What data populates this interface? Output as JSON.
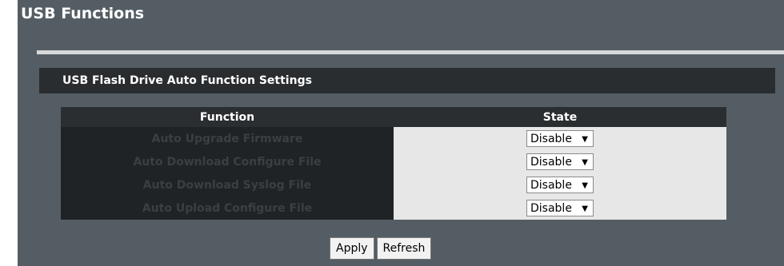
{
  "page": {
    "title": "USB Functions"
  },
  "section": {
    "title": "USB Flash Drive Auto Function Settings"
  },
  "table": {
    "columns": [
      "Function",
      "State"
    ],
    "rows": [
      {
        "function": "Auto Upgrade Firmware",
        "state": "Disable"
      },
      {
        "function": "Auto Download Configure File",
        "state": "Disable"
      },
      {
        "function": "Auto Download Syslog File",
        "state": "Disable"
      },
      {
        "function": "Auto Upload Configure File",
        "state": "Disable"
      }
    ]
  },
  "buttons": {
    "apply": "Apply",
    "refresh": "Refresh"
  },
  "icons": {
    "dropdown": "chevron-down-icon"
  },
  "colors": {
    "panel_bg": "#555d64",
    "header_bg": "#2a2d30",
    "divider": "#d6d9db",
    "function_cell_bg": "#1f2326",
    "state_cell_bg": "#e7e7e7"
  }
}
